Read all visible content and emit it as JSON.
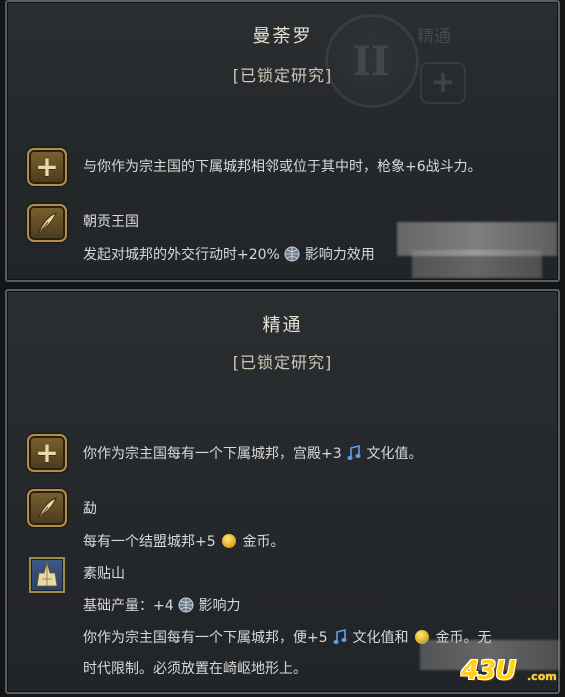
{
  "top_panel": {
    "title": "曼荼罗",
    "subtitle": "[已锁定研究]",
    "watermark_numeral": "II",
    "watermark_text": "精通",
    "bonus_text": "与你作为宗主国的下属城邦相邻或位于其中时，枪象+6战斗力。",
    "ability_name": "朝贡王国",
    "ability_text_prefix": "发起对城邦的外交行动时+20%",
    "ability_text_suffix": "影响力效用"
  },
  "bottom_panel": {
    "title": "精通",
    "subtitle": "[已锁定研究]",
    "bonus_text_prefix": "你作为宗主国每有一个下属城邦，宫殿+3",
    "bonus_text_suffix": "文化值。",
    "ability_name": "勐",
    "ability_text_prefix": "每有一个结盟城邦+5",
    "ability_text_suffix": "金币。",
    "wonder_name": "素贴山",
    "wonder_yield_prefix": "基础产量：+4",
    "wonder_yield_suffix": "影响力",
    "wonder_effect_prefix": "你作为宗主国每有一个下属城邦，便+5",
    "wonder_effect_mid": "文化值和",
    "wonder_effect_suffix": "金币。无",
    "wonder_note": "时代限制。必须放置在崎岖地形上。"
  },
  "icons": {
    "plus": "plus-badge-icon",
    "quill": "quill-badge-icon",
    "landmark": "wonder-landmark-icon",
    "influence": "influence-globe-icon",
    "culture": "music-note-icon",
    "gold": "gold-coin-icon"
  },
  "colors": {
    "panel_bg": "#2b2e31",
    "border": "#5a5d60",
    "badge_gold": "#b38f46",
    "culture_blue": "#5aa0e8",
    "gold_coin": "#d9a416"
  },
  "watermark": {
    "logo_text": "43U",
    "logo_suffix": ".com"
  }
}
